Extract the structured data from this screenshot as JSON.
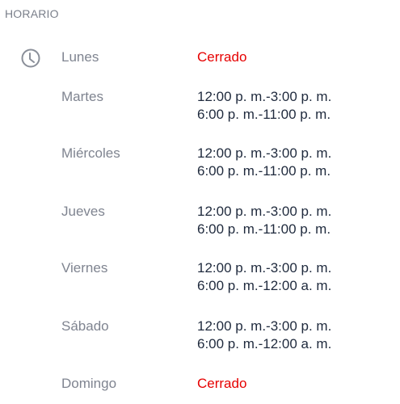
{
  "section": {
    "title": "HORARIO"
  },
  "icons": {
    "clock": "clock-icon"
  },
  "colors": {
    "closed": "#e60000",
    "hours_text": "#1f2a3d",
    "day_text": "#7f8490",
    "header_text": "#7a7f8a"
  },
  "schedule": [
    {
      "day": "Lunes",
      "closed": true,
      "lines": [
        "Cerrado"
      ]
    },
    {
      "day": "Martes",
      "closed": false,
      "lines": [
        "12:00 p. m.-3:00 p. m.",
        "6:00 p. m.-11:00 p. m."
      ]
    },
    {
      "day": "Miércoles",
      "closed": false,
      "lines": [
        "12:00 p. m.-3:00 p. m.",
        "6:00 p. m.-11:00 p. m."
      ]
    },
    {
      "day": "Jueves",
      "closed": false,
      "lines": [
        "12:00 p. m.-3:00 p. m.",
        "6:00 p. m.-11:00 p. m."
      ]
    },
    {
      "day": "Viernes",
      "closed": false,
      "lines": [
        "12:00 p. m.-3:00 p. m.",
        "6:00 p. m.-12:00 a. m."
      ]
    },
    {
      "day": "Sábado",
      "closed": false,
      "lines": [
        "12:00 p. m.-3:00 p. m.",
        "6:00 p. m.-12:00 a. m."
      ]
    },
    {
      "day": "Domingo",
      "closed": true,
      "lines": [
        "Cerrado"
      ]
    }
  ]
}
